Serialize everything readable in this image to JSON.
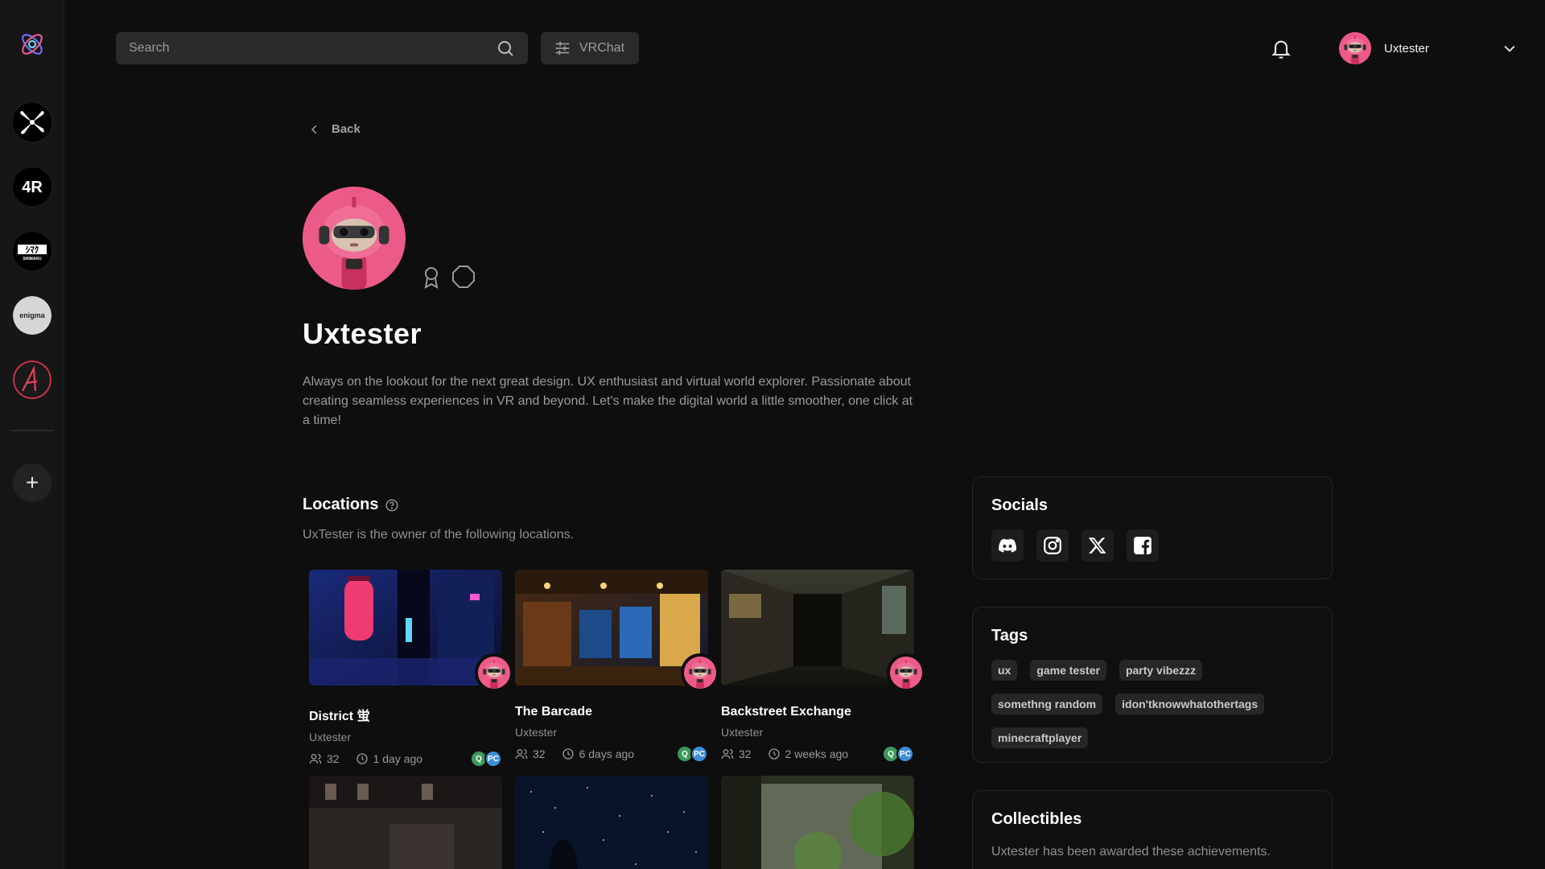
{
  "search": {
    "placeholder": "Search"
  },
  "platform_filter": {
    "label": "VRChat"
  },
  "user_menu": {
    "username": "Uxtester"
  },
  "rail": {
    "servers": [
      {
        "name": "Pinwheel community",
        "icon": "pinwheel-icon"
      },
      {
        "name": "4R",
        "icon": "4r-logo"
      },
      {
        "name": "SHIMAKU",
        "icon": "shimaku-logo"
      },
      {
        "name": "enigma",
        "icon": "enigma-logo"
      },
      {
        "name": "A community",
        "icon": "a-logo"
      }
    ],
    "add_label": "+"
  },
  "back": {
    "label": "Back"
  },
  "profile": {
    "name": "Uxtester",
    "bio": "Always on the lookout for the next great design. UX enthusiast and virtual world explorer. Passionate about creating seamless experiences in VR and beyond. Let's make the digital world a little smoother, one click at a time!",
    "badges": [
      "ribbon-badge-icon",
      "octagon-badge-icon"
    ]
  },
  "locations": {
    "title": "Locations",
    "subtitle": "UxTester is the owner of the following locations.",
    "cards": [
      {
        "title": "District 蛍",
        "author": "Uxtester",
        "users": "32",
        "time": "1 day ago",
        "platforms": [
          "Q",
          "PC"
        ]
      },
      {
        "title": "The Barcade",
        "author": "Uxtester",
        "users": "32",
        "time": "6 days ago",
        "platforms": [
          "Q",
          "PC"
        ]
      },
      {
        "title": "Backstreet Exchange",
        "author": "Uxtester",
        "users": "32",
        "time": "2 weeks ago",
        "platforms": [
          "Q",
          "PC"
        ]
      }
    ]
  },
  "socials": {
    "title": "Socials",
    "links": [
      "discord-icon",
      "instagram-icon",
      "x-icon",
      "facebook-icon"
    ]
  },
  "tags": {
    "title": "Tags",
    "items": [
      "ux",
      "game tester",
      "party vibezzz",
      "somethng random",
      "idon'tknowwhatothertags",
      "minecraftplayer"
    ]
  },
  "collectibles": {
    "title": "Collectibles",
    "subtitle": "Uxtester has been awarded these achievements."
  },
  "colors": {
    "background": "#0e0e0e",
    "rail": "#161616",
    "avatar_pink": "#e8497a"
  }
}
